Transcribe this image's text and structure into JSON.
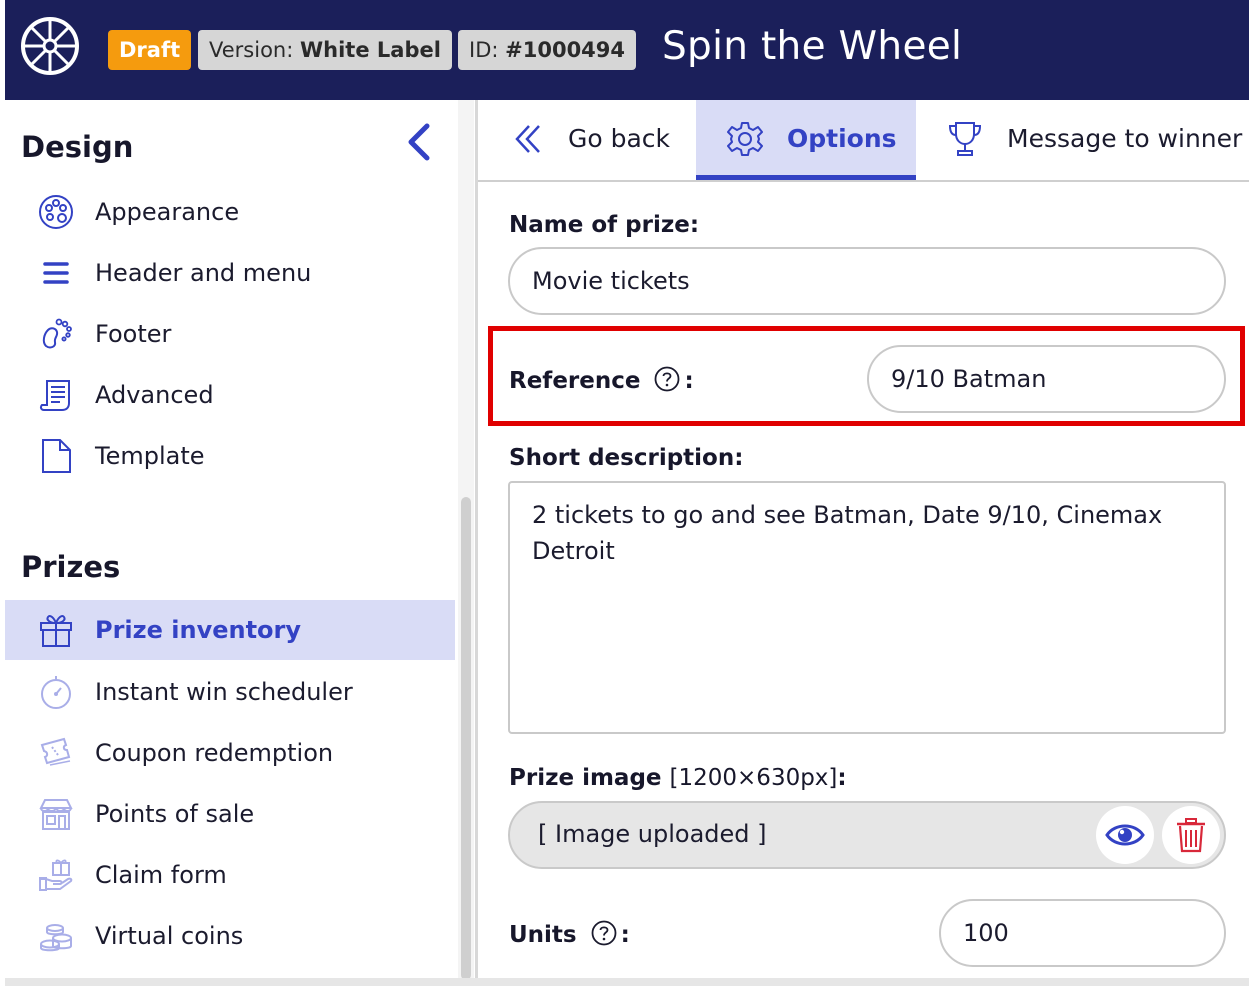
{
  "header": {
    "logo_icon": "wheel-icon",
    "badge_draft": "Draft",
    "version_label": "Version:",
    "version_value": "White Label",
    "id_label": "ID:",
    "id_value": "#1000494",
    "title": "Spin the Wheel",
    "colors": {
      "bar": "#1b1f5a",
      "draft": "#f59b0e"
    }
  },
  "sidebar": {
    "design_title": "Design",
    "design_items": [
      {
        "label": "Appearance",
        "icon": "palette-icon"
      },
      {
        "label": "Header and menu",
        "icon": "hamburger-menu-icon"
      },
      {
        "label": "Footer",
        "icon": "footprint-icon"
      },
      {
        "label": "Advanced",
        "icon": "scroll-document-icon"
      },
      {
        "label": "Template",
        "icon": "blank-page-icon"
      }
    ],
    "prizes_title": "Prizes",
    "prize_items": [
      {
        "label": "Prize inventory",
        "icon": "gift-icon",
        "active": true
      },
      {
        "label": "Instant win scheduler",
        "icon": "stopwatch-icon"
      },
      {
        "label": "Coupon redemption",
        "icon": "coupon-icon"
      },
      {
        "label": "Points of sale",
        "icon": "storefront-icon"
      },
      {
        "label": "Claim form",
        "icon": "hand-gift-icon"
      },
      {
        "label": "Virtual coins",
        "icon": "coins-icon"
      }
    ],
    "accent": "#3342c4"
  },
  "tabs": [
    {
      "label": "Go back",
      "icon": "double-chevron-left-icon"
    },
    {
      "label": "Options",
      "icon": "gear-icon",
      "active": true
    },
    {
      "label": "Message to winner",
      "icon": "trophy-icon"
    }
  ],
  "form": {
    "name_label": "Name of prize:",
    "name_value": "Movie tickets",
    "reference_label": "Reference",
    "reference_colon": ":",
    "reference_value": "9/10 Batman",
    "short_desc_label": "Short description:",
    "short_desc_value": "2 tickets to go and see Batman, Date 9/10, Cinemax Detroit",
    "image_label": "Prize image",
    "image_size": "[1200×630px]",
    "image_colon": ":",
    "image_status": "[ Image uploaded ]",
    "units_label": "Units",
    "units_colon": ":",
    "units_value": "100",
    "highlight_color": "#e00000"
  }
}
